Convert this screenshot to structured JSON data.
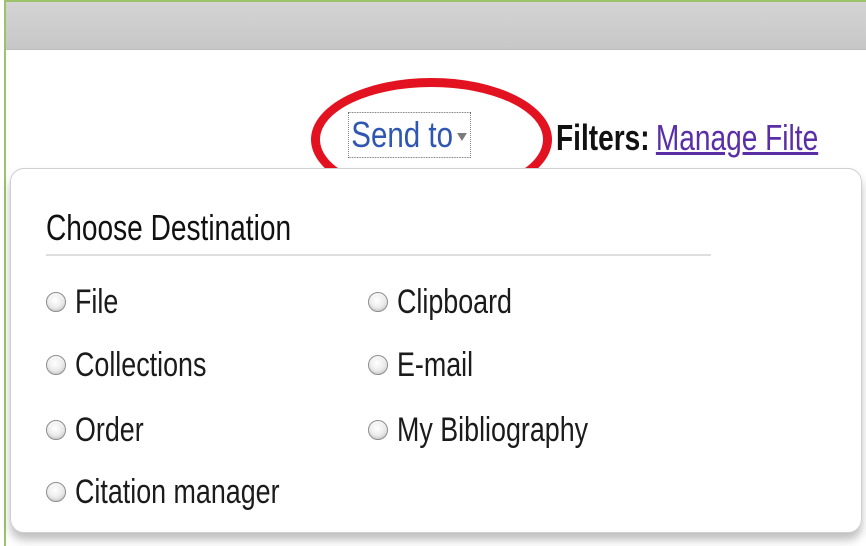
{
  "toolbar": {
    "send_to_label": "Send to",
    "send_to_icon": "dropdown-arrow-icon",
    "filters_label": "Filters:",
    "manage_filters_link": "Manage Filte"
  },
  "dropdown": {
    "title": "Choose Destination",
    "options": [
      {
        "label": "File"
      },
      {
        "label": "Clipboard"
      },
      {
        "label": "Collections"
      },
      {
        "label": "E-mail"
      },
      {
        "label": "Order"
      },
      {
        "label": "My Bibliography"
      },
      {
        "label": "Citation manager"
      }
    ]
  },
  "colors": {
    "accent_link": "#2f56b0",
    "visited_link": "#5a2ea6",
    "highlight_circle": "#e31220",
    "frame_border": "#9cc36b",
    "header_gray": "#cccccc"
  }
}
